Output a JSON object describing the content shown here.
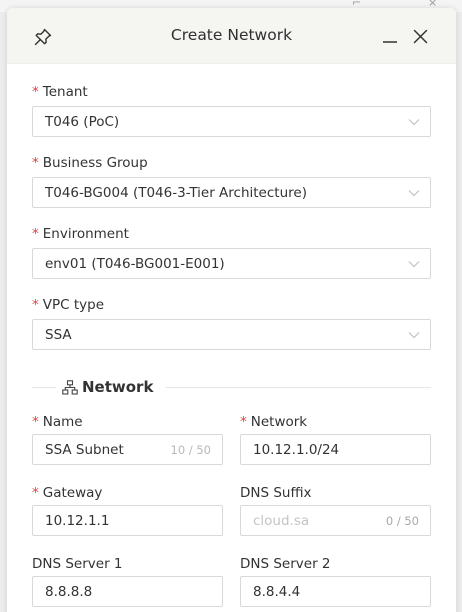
{
  "dialog": {
    "title": "Create Network"
  },
  "form": {
    "tenant": {
      "label": "Tenant",
      "value": "T046 (PoC)",
      "required": true
    },
    "business_group": {
      "label": "Business Group",
      "value": "T046-BG004 (T046-3-Tier Architecture)",
      "required": true
    },
    "environment": {
      "label": "Environment",
      "value": "env01 (T046-BG001-E001)",
      "required": true
    },
    "vpc_type": {
      "label": "VPC type",
      "value": "SSA",
      "required": true
    },
    "network_section": {
      "title": "Network"
    },
    "name": {
      "label": "Name",
      "value": "SSA Subnet",
      "counter": "10 / 50",
      "required": true
    },
    "network": {
      "label": "Network",
      "value": "10.12.1.0/24",
      "required": true
    },
    "gateway": {
      "label": "Gateway",
      "value": "10.12.1.1",
      "required": true
    },
    "dns_suffix": {
      "label": "DNS Suffix",
      "placeholder": "cloud.sa",
      "counter": "0 / 50",
      "required": false
    },
    "dns_server_1": {
      "label": "DNS Server 1",
      "value": "8.8.8.8",
      "required": false
    },
    "dns_server_2": {
      "label": "DNS Server 2",
      "value": "8.8.4.4",
      "required": false
    }
  },
  "colors": {
    "required_asterisk": "#e23d3d",
    "header_bg": "#f5f5f2",
    "border": "#d9d9d9"
  },
  "icons": {
    "header_left": "pin-icon",
    "header_minimize": "minimize-icon",
    "header_close": "close-icon",
    "select_arrow": "chevron-down-icon",
    "section": "network-topology-icon"
  }
}
